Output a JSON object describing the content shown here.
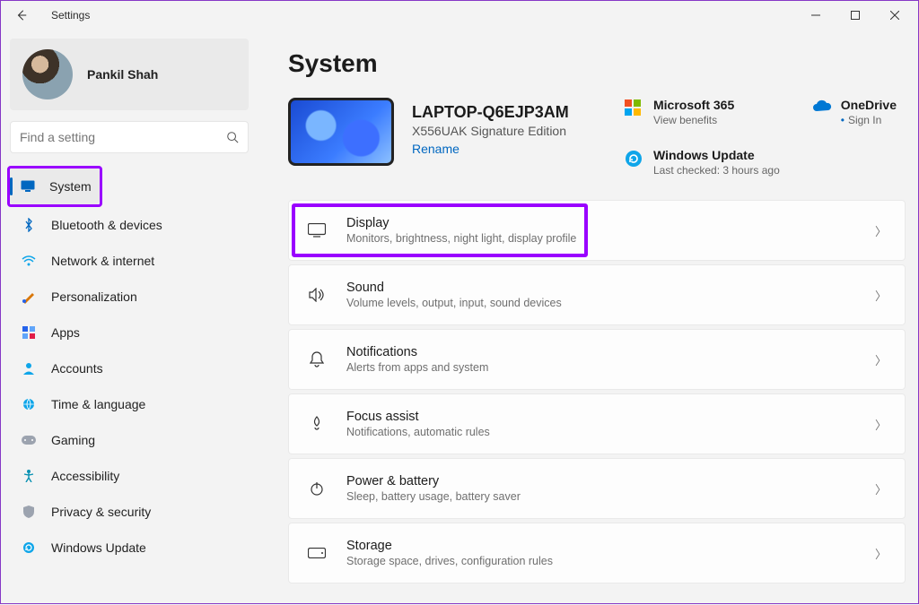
{
  "app": {
    "name": "Settings"
  },
  "user": {
    "name": "Pankil Shah"
  },
  "search": {
    "placeholder": "Find a setting"
  },
  "sidebar": {
    "items": [
      {
        "label": "System"
      },
      {
        "label": "Bluetooth & devices"
      },
      {
        "label": "Network & internet"
      },
      {
        "label": "Personalization"
      },
      {
        "label": "Apps"
      },
      {
        "label": "Accounts"
      },
      {
        "label": "Time & language"
      },
      {
        "label": "Gaming"
      },
      {
        "label": "Accessibility"
      },
      {
        "label": "Privacy & security"
      },
      {
        "label": "Windows Update"
      }
    ]
  },
  "page": {
    "title": "System",
    "device": {
      "name": "LAPTOP-Q6EJP3AM",
      "model": "X556UAK Signature Edition",
      "rename": "Rename"
    },
    "tiles": {
      "m365": {
        "title": "Microsoft 365",
        "sub": "View benefits"
      },
      "onedrive": {
        "title": "OneDrive",
        "sub": "Sign In"
      },
      "update": {
        "title": "Windows Update",
        "sub": "Last checked: 3 hours ago"
      }
    },
    "settings": [
      {
        "title": "Display",
        "sub": "Monitors, brightness, night light, display profile"
      },
      {
        "title": "Sound",
        "sub": "Volume levels, output, input, sound devices"
      },
      {
        "title": "Notifications",
        "sub": "Alerts from apps and system"
      },
      {
        "title": "Focus assist",
        "sub": "Notifications, automatic rules"
      },
      {
        "title": "Power & battery",
        "sub": "Sleep, battery usage, battery saver"
      },
      {
        "title": "Storage",
        "sub": "Storage space, drives, configuration rules"
      }
    ]
  }
}
